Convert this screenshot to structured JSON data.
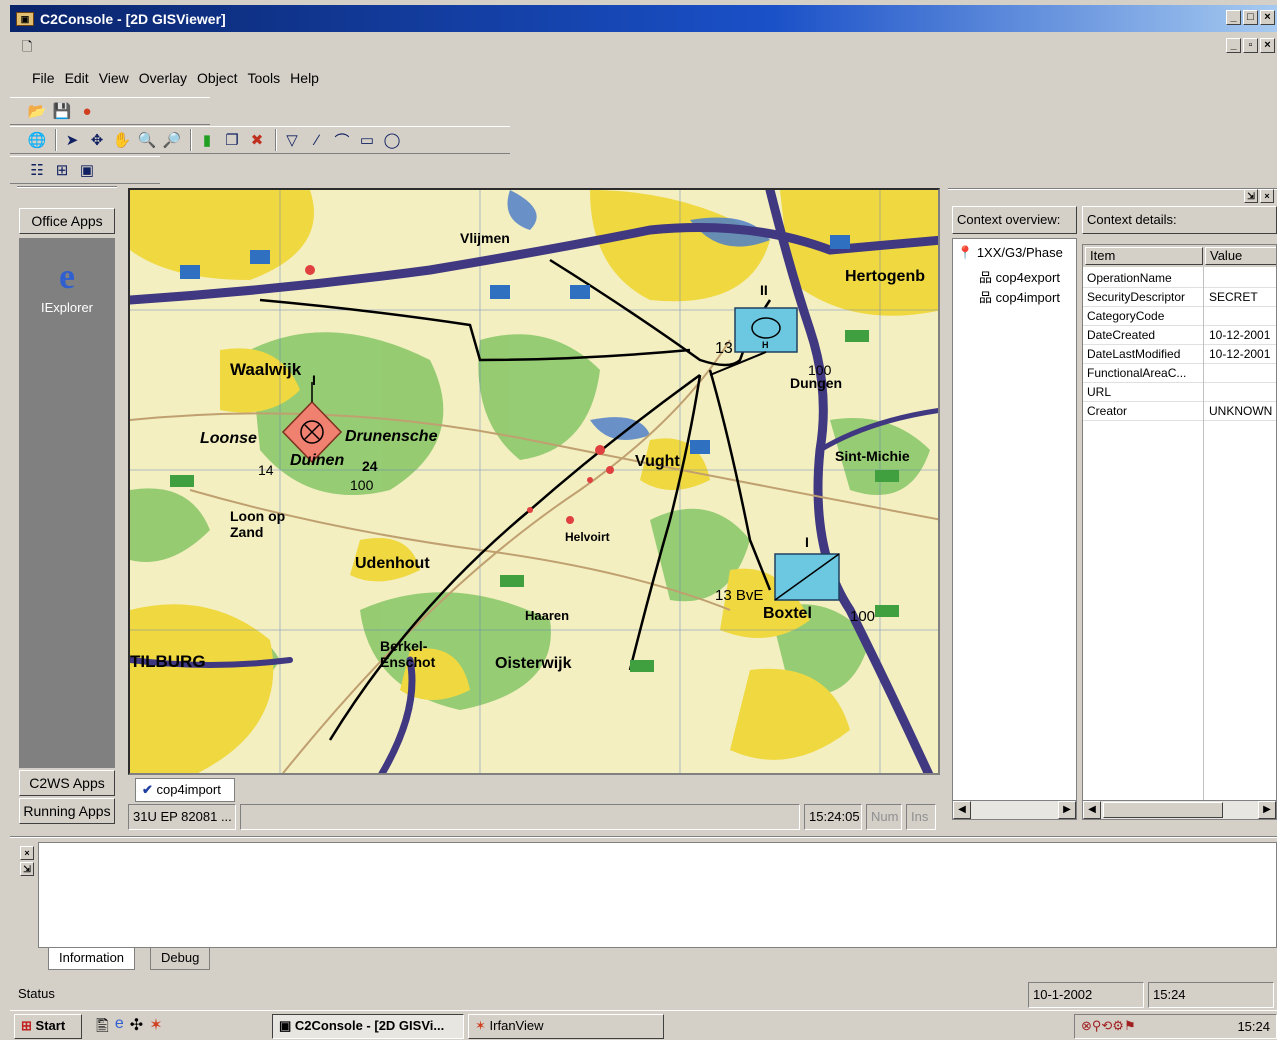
{
  "window": {
    "title": "C2Console - [2D GISViewer]",
    "title_icon": "console-icon"
  },
  "menu": [
    "File",
    "Edit",
    "View",
    "Overlay",
    "Object",
    "Tools",
    "Help"
  ],
  "left_panel": {
    "top_button": "Office Apps",
    "app_label": "IExplorer",
    "bottom_buttons": [
      "C2WS Apps",
      "Running Apps"
    ]
  },
  "map": {
    "labels": {
      "waalwijk": "Waalwijk",
      "loonse": "Loonse",
      "drunense": "Drunensche",
      "duinen": "Duinen",
      "udenhout": "Udenhout",
      "tilburg": "TILBURG",
      "vught": "Vught",
      "hertogenb": "Hertogenb",
      "boxtel": "Boxtel",
      "oisterwijk": "Oisterwijk",
      "berkel": "Berkel-Enschot",
      "loon_zand": "Loon op Zand",
      "dungen": "Dungen",
      "helvoirt": "Helvoirt",
      "sint_michiel": "Sint-Michie",
      "haaren": "Haaren",
      "vlijmen": "Vlijmen"
    },
    "unit_labels": {
      "u13": "13",
      "u100a": "100",
      "u14": "14",
      "u24": "24",
      "u100b": "100",
      "u13bve": "13 BvE",
      "u100c": "100",
      "u_top": "II",
      "u_mid": "I",
      "u_bot": "I",
      "u_h": "H"
    },
    "colors": {
      "land": "#f3efc0",
      "forest": "#8cc86a",
      "urban": "#f0d840",
      "water": "#5080c8",
      "highway": "#403880",
      "friendly": "#6cc8e0",
      "hostile": "#f08070"
    }
  },
  "map_tab": "cop4import",
  "map_status": {
    "coords": "31U EP 82081 ...",
    "time": "15:24:05",
    "num": "Num",
    "ins": "Ins"
  },
  "context": {
    "overview_label": "Context overview:",
    "details_label": "Context details:",
    "tree_root": "1XX/G3/Phase",
    "tree_children": [
      "cop4export",
      "cop4import"
    ],
    "grid_headers": [
      "Item",
      "Value"
    ],
    "rows": [
      {
        "item": "OperationName",
        "value": ""
      },
      {
        "item": "SecurityDescriptor",
        "value": "SECRET"
      },
      {
        "item": "CategoryCode",
        "value": ""
      },
      {
        "item": "DateCreated",
        "value": "10-12-2001"
      },
      {
        "item": "DateLastModified",
        "value": "10-12-2001"
      },
      {
        "item": "FunctionalAreaC...",
        "value": ""
      },
      {
        "item": "URL",
        "value": ""
      },
      {
        "item": "Creator",
        "value": "UNKNOWN"
      }
    ]
  },
  "bottom_tabs": [
    "Information",
    "Debug"
  ],
  "status": {
    "label": "Status",
    "date": "10-1-2002",
    "time": "15:24"
  },
  "taskbar": {
    "start": "Start",
    "tasks": [
      "C2Console - [2D GISVi...",
      "IrfanView"
    ],
    "clock": "15:24"
  }
}
